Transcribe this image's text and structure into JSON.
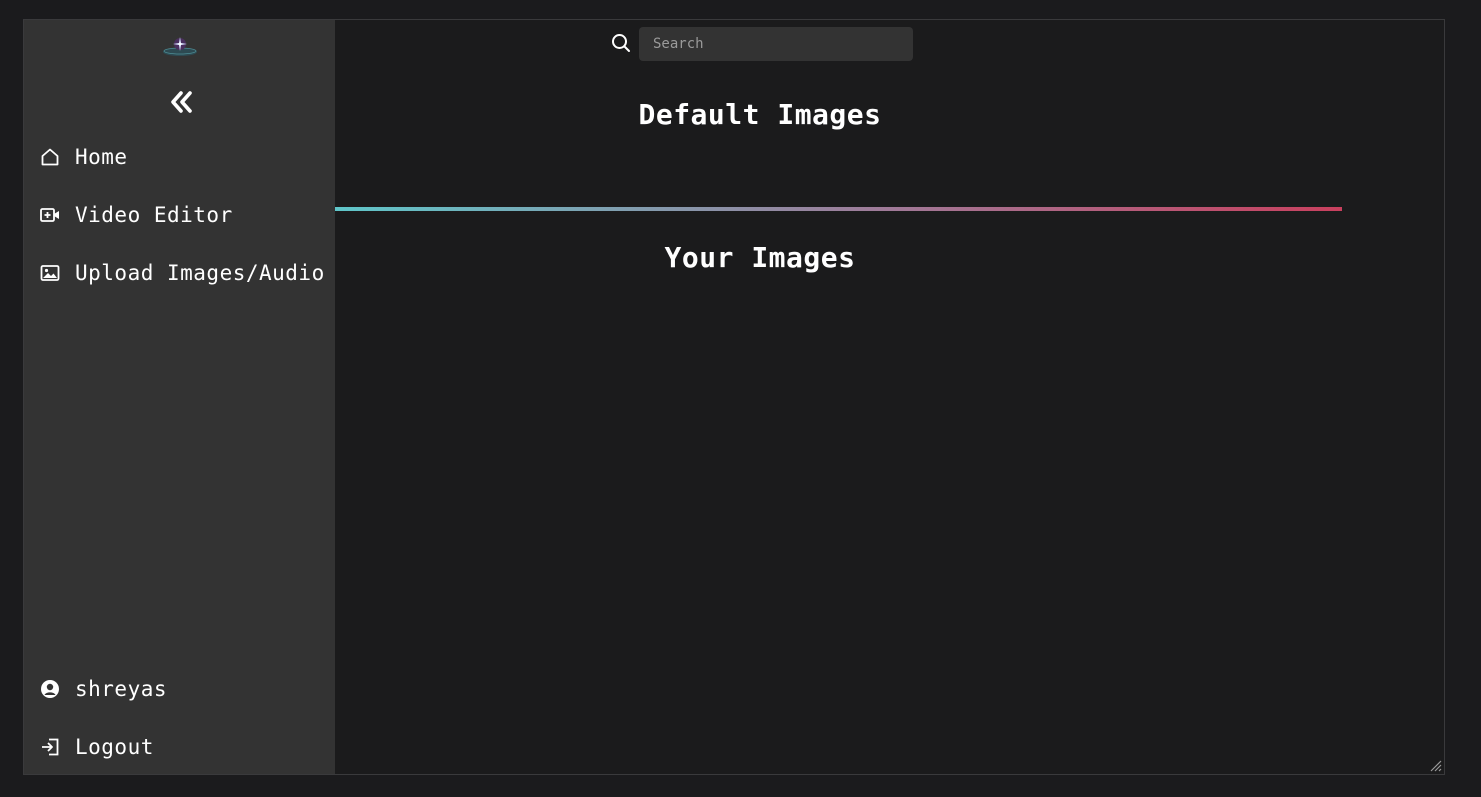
{
  "sidebar": {
    "collapse_icon": "double-chevron-left-icon",
    "items": [
      {
        "label": "Home",
        "icon": "home-icon"
      },
      {
        "label": "Video Editor",
        "icon": "video-plus-icon"
      },
      {
        "label": "Upload Images/Audio",
        "icon": "image-icon"
      }
    ],
    "user": {
      "label": "shreyas",
      "icon": "user-circle-icon"
    },
    "logout": {
      "label": "Logout",
      "icon": "logout-icon"
    }
  },
  "search": {
    "placeholder": "Search",
    "value": ""
  },
  "main": {
    "default_heading": "Default Images",
    "your_heading": "Your Images"
  },
  "colors": {
    "background": "#1b1b1c",
    "sidebar": "#333333",
    "divider_start": "#5fc6c9",
    "divider_end": "#c9405e"
  }
}
